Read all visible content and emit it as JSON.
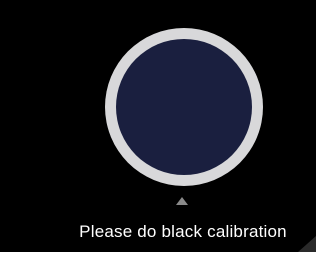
{
  "screen": {
    "message": "Please do black calibration"
  },
  "sensor": {
    "ring_color": "#d8d8da",
    "face_color": "#1a1f3f",
    "icon": "calibration-sensor-icon"
  },
  "indicator": {
    "icon": "triangle-up-icon",
    "color": "#8a8a8a"
  }
}
